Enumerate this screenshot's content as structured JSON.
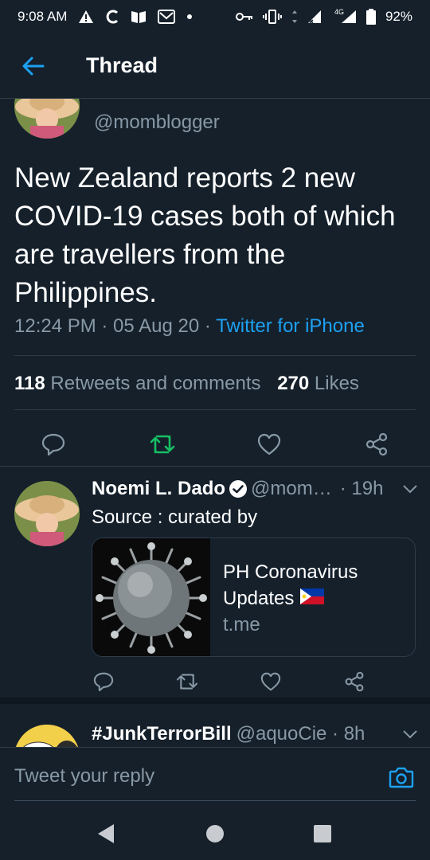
{
  "status_bar": {
    "time": "9:08 AM",
    "network": "4G",
    "battery": "92%"
  },
  "header": {
    "title": "Thread"
  },
  "main_tweet": {
    "handle": "@momblogger",
    "text": "New Zealand reports 2 new COVID-19 cases both of which are travellers from the Philippines.",
    "time_date": "12:24 PM · 05 Aug 20 · ",
    "source": "Twitter for iPhone",
    "retweets_count": "118",
    "retweets_label": "Retweets and comments",
    "likes_count": "270",
    "likes_label": "Likes",
    "retweet_color": "#17bf63"
  },
  "reply_tweet": {
    "name": "Noemi L. Dado",
    "handle": "@mom…",
    "time": "· 19h",
    "text": "Source : curated by",
    "card": {
      "title_line1": "PH Coronavirus",
      "title_line2": "Updates",
      "domain": "t.me"
    }
  },
  "next_tweet": {
    "name": "#JunkTerrorBill",
    "handle": "@aquoCie · 8h"
  },
  "composer": {
    "placeholder": "Tweet your reply"
  },
  "colors": {
    "background": "#15202b",
    "accent": "#1da1f2",
    "secondary_text": "#8899a6"
  }
}
